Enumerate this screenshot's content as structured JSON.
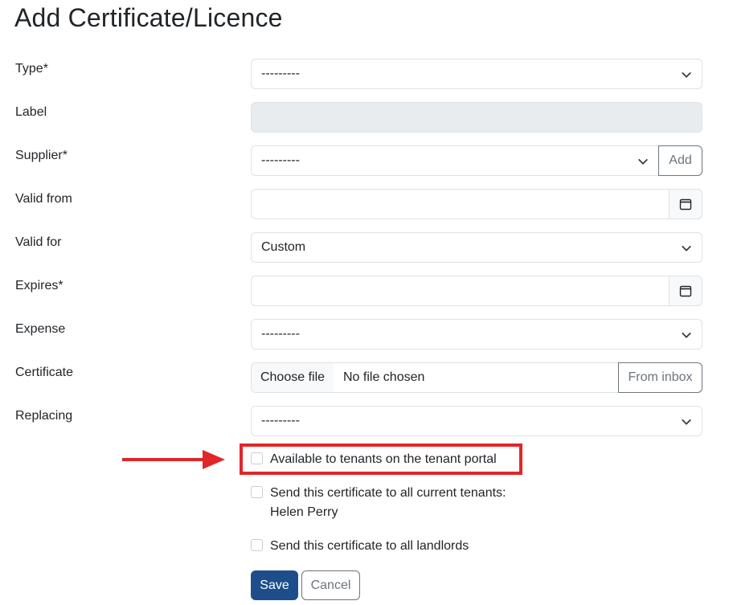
{
  "title": "Add Certificate/Licence",
  "fields": {
    "type": {
      "label": "Type*",
      "value": "---------"
    },
    "label": {
      "label": "Label",
      "value": ""
    },
    "supplier": {
      "label": "Supplier*",
      "value": "---------",
      "add_label": "Add"
    },
    "valid_from": {
      "label": "Valid from",
      "value": ""
    },
    "valid_for": {
      "label": "Valid for",
      "value": "Custom"
    },
    "expires": {
      "label": "Expires*",
      "value": ""
    },
    "expense": {
      "label": "Expense",
      "value": "---------"
    },
    "certificate": {
      "label": "Certificate",
      "choose_label": "Choose file",
      "status": "No file chosen",
      "inbox_label": "From inbox"
    },
    "replacing": {
      "label": "Replacing",
      "value": "---------"
    }
  },
  "checkboxes": {
    "tenant_portal": {
      "label": "Available to tenants on the tenant portal",
      "checked": false
    },
    "send_tenants": {
      "label": "Send this certificate to all current tenants:",
      "tenant_name": "Helen Perry",
      "checked": false
    },
    "send_landlords": {
      "label": "Send this certificate to all landlords",
      "checked": false
    }
  },
  "buttons": {
    "save": "Save",
    "cancel": "Cancel"
  },
  "colors": {
    "highlight": "#e1262a",
    "primary": "#1d4e89"
  },
  "icons": {
    "dropdown": "chevron-down-icon",
    "date": "calendar-icon",
    "annotation": "arrow-right-icon"
  }
}
